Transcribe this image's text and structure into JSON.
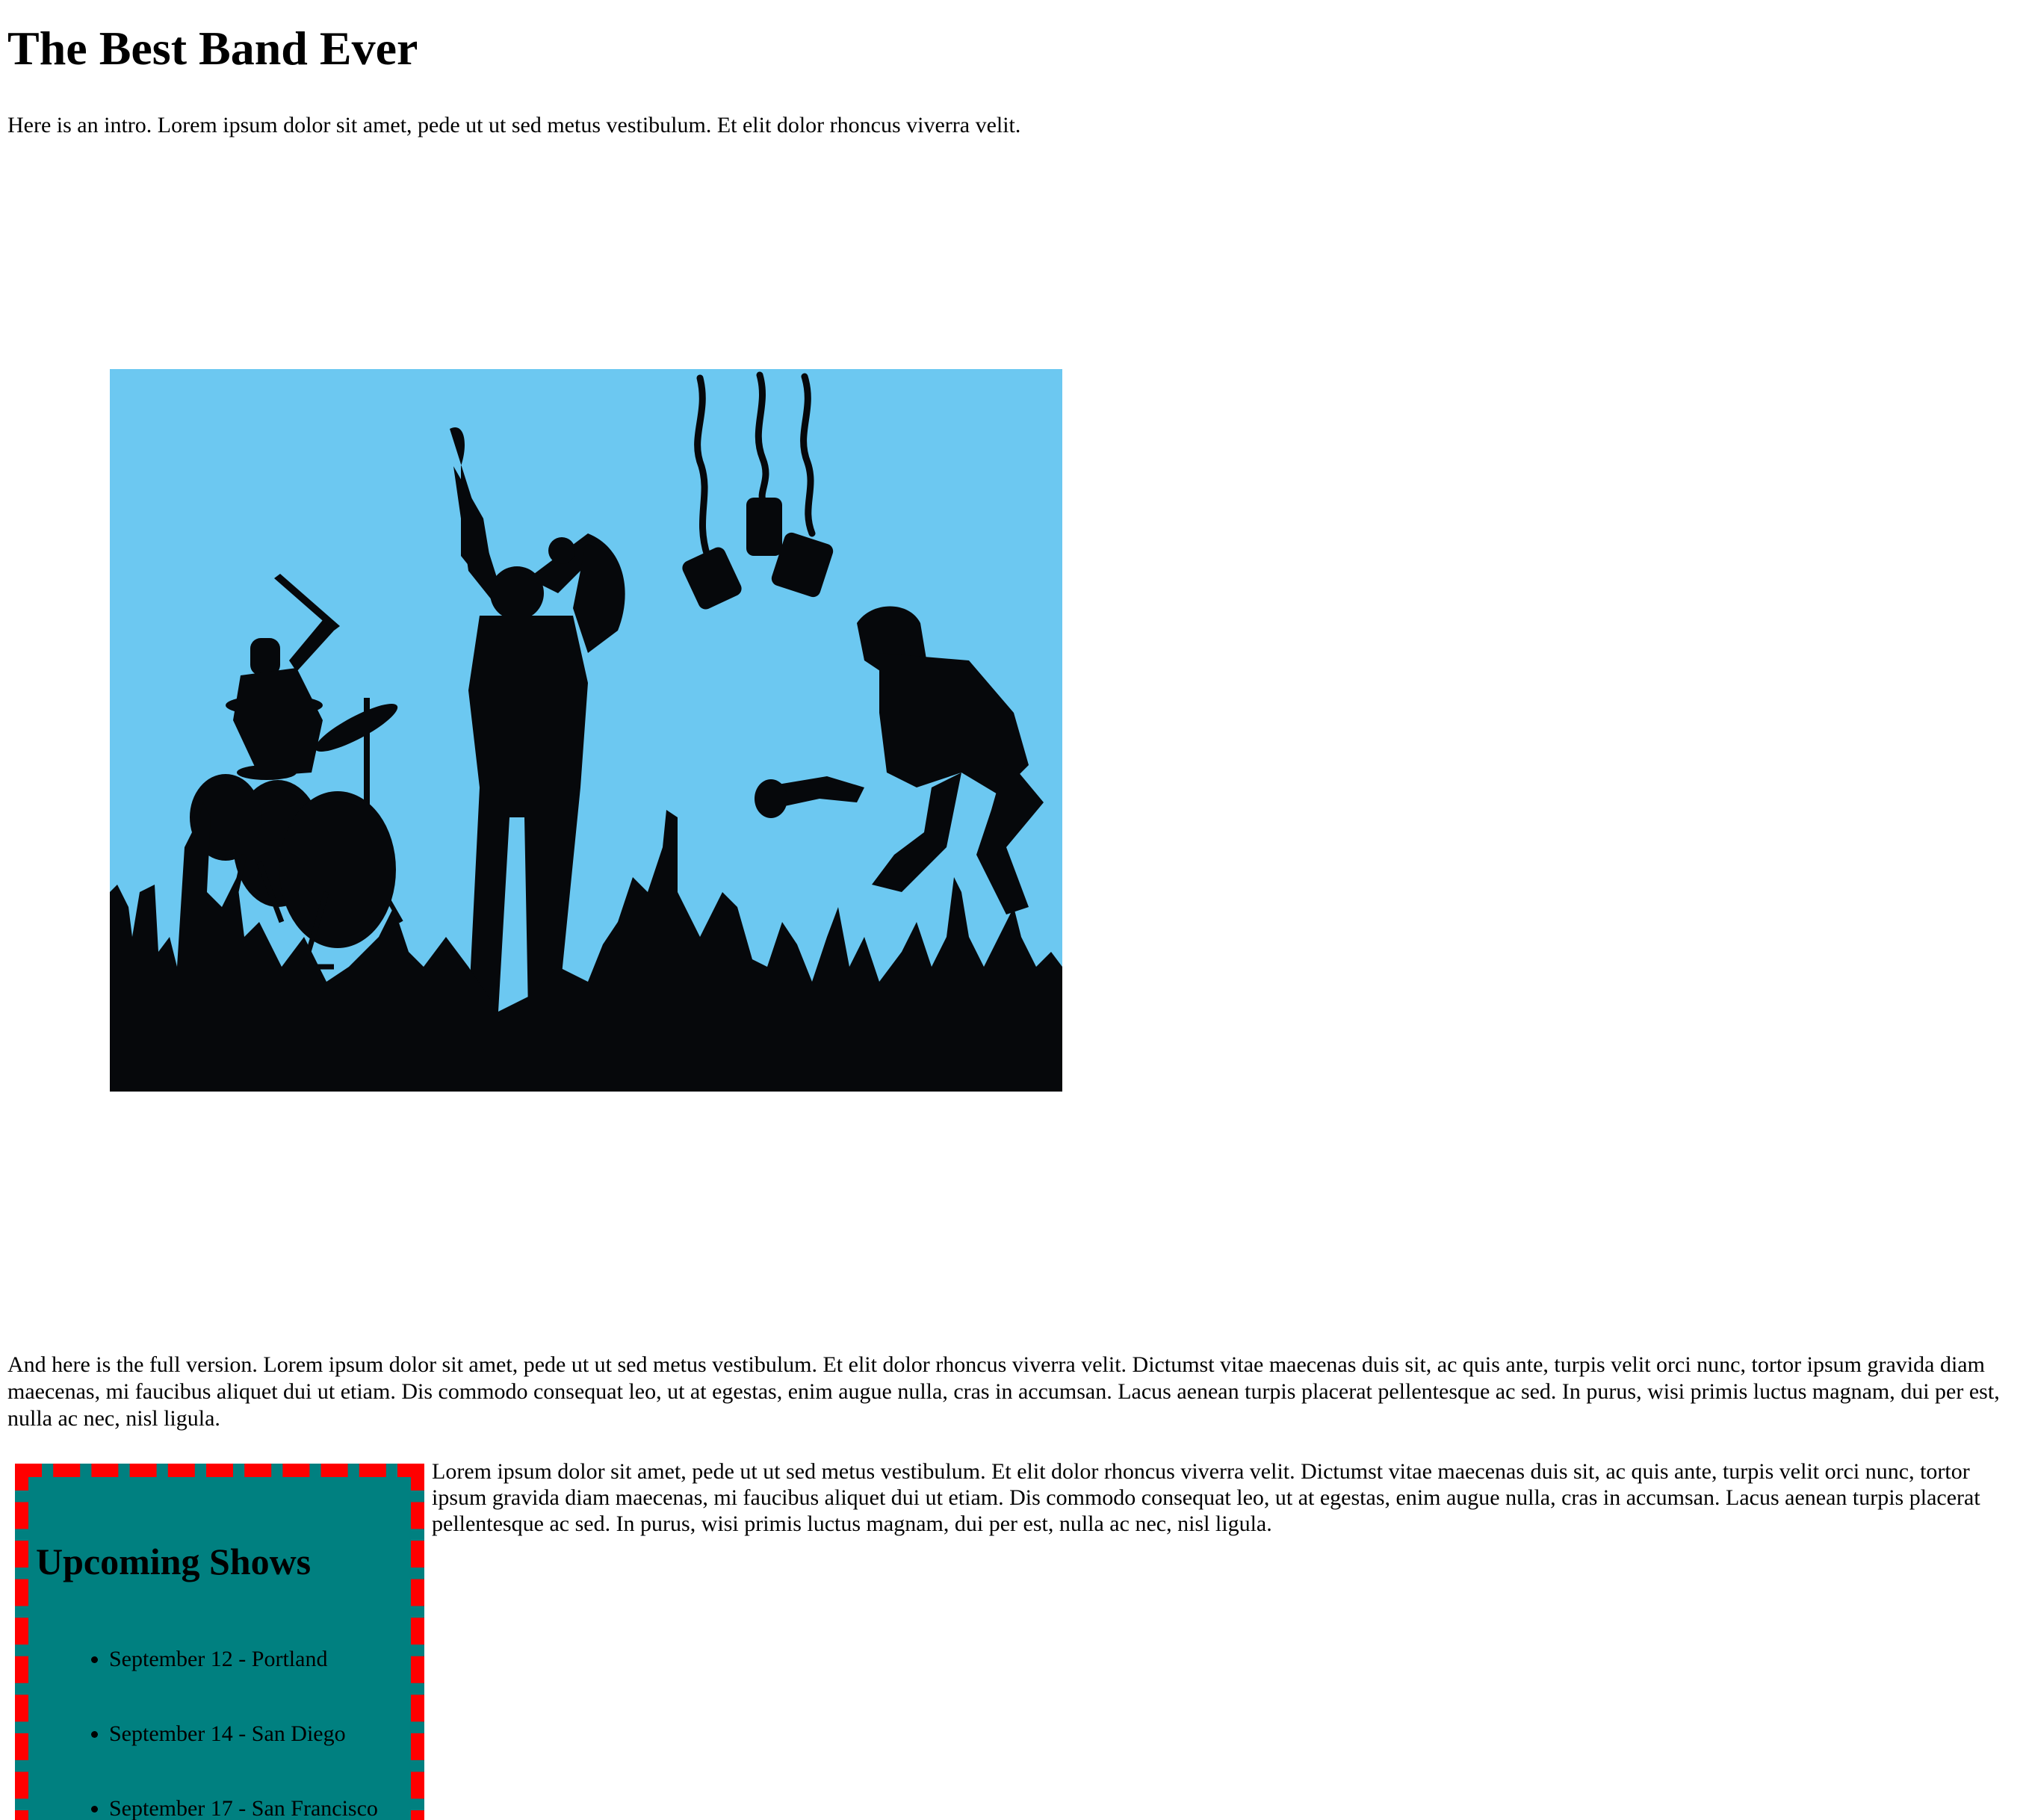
{
  "header": {
    "title": "The Best Band Ever"
  },
  "intro": {
    "text": "Here is an intro. Lorem ipsum dolor sit amet, pede ut ut sed metus vestibulum. Et elit dolor rhoncus viverra velit."
  },
  "hero_image": {
    "description": "band-silhouette-illustration",
    "sky_color": "#6cc8f1",
    "silhouette_color": "#06080b"
  },
  "full_version": {
    "text": "And here is the full version. Lorem ipsum dolor sit amet, pede ut ut sed metus vestibulum. Et elit dolor rhoncus viverra velit. Dictumst vitae maecenas duis sit, ac quis ante, turpis velit orci nunc, tortor ipsum gravida diam maecenas, mi faucibus aliquet dui ut etiam. Dis commodo consequat leo, ut at egestas, enim augue nulla, cras in accumsan. Lacus aenean turpis placerat pellentesque ac sed. In purus, wisi primis luctus magnam, dui per est, nulla ac nec, nisl ligula."
  },
  "upcoming_shows": {
    "title": "Upcoming Shows",
    "background_color": "#008080",
    "border_color": "#ff0000",
    "items": [
      "September 12 - Portland",
      "September 14 - San Diego",
      "September 17 - San Francisco"
    ]
  },
  "side_text": {
    "text": "Lorem ipsum dolor sit amet, pede ut ut sed metus vestibulum. Et elit dolor rhoncus viverra velit. Dictumst vitae maecenas duis sit, ac quis ante, turpis velit orci nunc, tortor ipsum gravida diam maecenas, mi faucibus aliquet dui ut etiam. Dis commodo consequat leo, ut at egestas, enim augue nulla, cras in accumsan. Lacus aenean turpis placerat pellentesque ac sed. In purus, wisi primis luctus magnam, dui per est, nulla ac nec, nisl ligula."
  }
}
